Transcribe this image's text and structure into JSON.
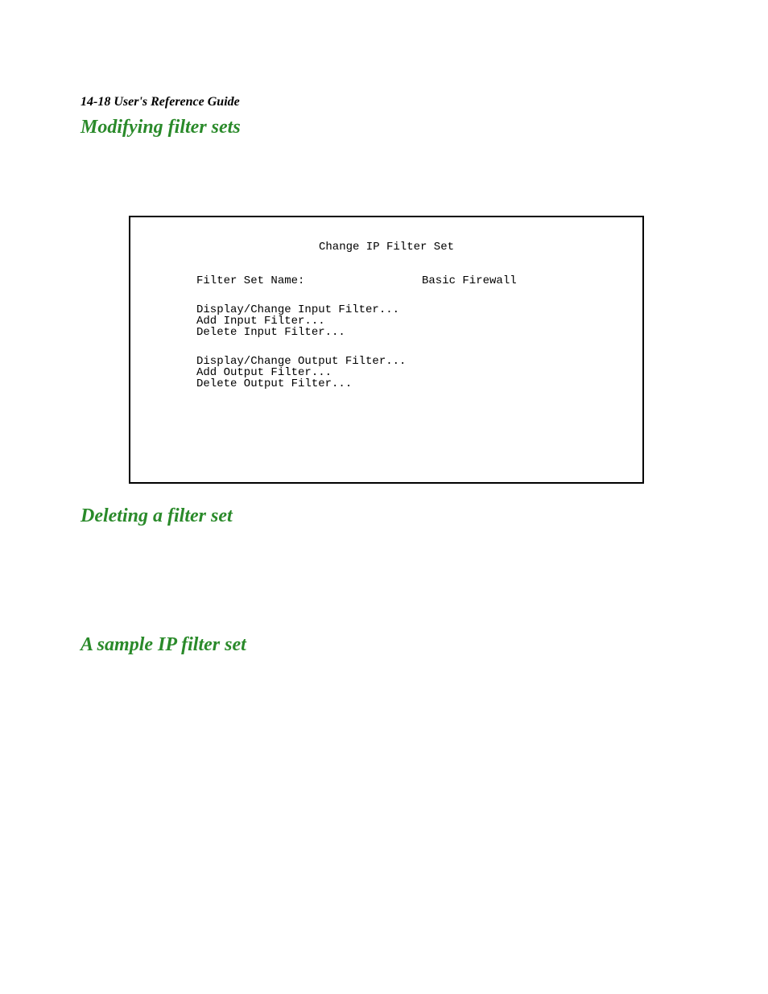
{
  "header": {
    "page_ref": "14-18  User's Reference Guide"
  },
  "headings": {
    "modifying": "Modifying filter sets",
    "deleting": "Deleting a filter set",
    "sample": "A sample IP filter set"
  },
  "terminal": {
    "title": "Change IP Filter Set",
    "name_row": {
      "label": "Filter Set Name:",
      "value": "Basic Firewall"
    },
    "input_group": {
      "line1": "Display/Change Input Filter...",
      "line2": "Add Input Filter...",
      "line3": "Delete Input Filter..."
    },
    "output_group": {
      "line1": "Display/Change Output Filter...",
      "line2": "Add Output Filter...",
      "line3": "Delete Output Filter..."
    }
  }
}
